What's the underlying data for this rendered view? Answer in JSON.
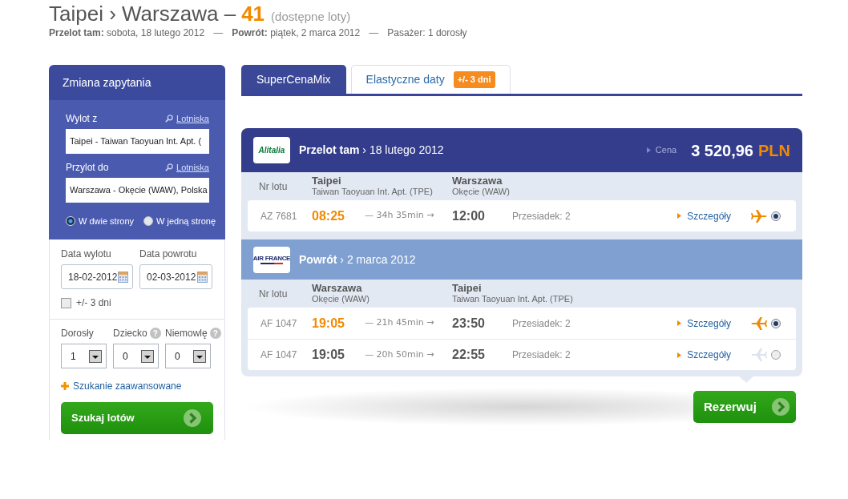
{
  "title": {
    "route": "Taipei › Warszawa –",
    "count": "41",
    "note": "(dostępne loty)"
  },
  "summary": {
    "items": [
      "**Przelot tam:** sobota, 18 lutego 2012",
      "**Powrót:** piątek, 2 marca 2012",
      "Pasażer: 1 dorosły"
    ],
    "separator": "—"
  },
  "sidebar": {
    "title": "Zmiana zapytania",
    "places": [
      {
        "label": "Wylot z",
        "link": "Lotniska",
        "value": "Taipei - Taiwan Taoyuan Int. Apt. ("
      },
      {
        "label": "Przylot do",
        "link": "Lotniska",
        "value": "Warszawa - Okęcie (WAW), Polska"
      }
    ],
    "trip_types": [
      {
        "label": "W dwie strony",
        "selected": true
      },
      {
        "label": "W jedną stronę",
        "selected": false
      }
    ],
    "dates": [
      {
        "label": "Data wylotu",
        "value": "18-02-2012"
      },
      {
        "label": "Data powrotu",
        "value": "02-03-2012"
      }
    ],
    "flexible_dates": {
      "label": "+/- 3 dni",
      "checked": false
    },
    "passengers": [
      {
        "label": "Dorosły",
        "value": "1"
      },
      {
        "label": "Dziecko",
        "help": "?",
        "value": "0"
      },
      {
        "label": "Niemowlę",
        "help": "?",
        "value": "0"
      }
    ],
    "advanced_search": "Szukanie zaawansowane",
    "search_button": "Szukaj lotów"
  },
  "tabs": [
    {
      "label": "SuperCenaMix",
      "selected": true
    },
    {
      "label": "Elastyczne daty",
      "badge": "+/- 3 dni",
      "selected": false
    }
  ],
  "legs": [
    {
      "kind": "outbound",
      "airline_logo": "Alitalia",
      "title": "**Przelot tam** › 18 lutego 2012",
      "price": {
        "label": "Cena",
        "amount": "3 520,96",
        "currency": "PLN"
      },
      "columns": {
        "flight_no": "Nr lotu",
        "from": {
          "city": "Taipei",
          "airport": "Taiwan Taoyuan Int. Apt. (TPE)"
        },
        "to": {
          "city": "Warszawa",
          "airport": "Okęcie (WAW)"
        }
      },
      "flights": [
        {
          "number": "AZ 7681",
          "departure": "08:25",
          "duration": "— 34h 35min →",
          "arrival": "12:00",
          "stops": "Przesiadek: 2",
          "details": "Szczegóły",
          "selected": true
        }
      ]
    },
    {
      "kind": "return",
      "airline_logo": "AIR FRANCE",
      "title": "**Powrót** › 2 marca 2012",
      "columns": {
        "flight_no": "Nr lotu",
        "from": {
          "city": "Warszawa",
          "airport": "Okęcie (WAW)"
        },
        "to": {
          "city": "Taipei",
          "airport": "Taiwan Taoyuan Int. Apt. (TPE)"
        }
      },
      "flights": [
        {
          "number": "AF 1047",
          "departure": "19:05",
          "duration": "— 21h 45min →",
          "arrival": "23:50",
          "stops": "Przesiadek: 2",
          "details": "Szczegóły",
          "selected": true
        },
        {
          "number": "AF 1047",
          "departure": "19:05",
          "duration": "— 20h 50min →",
          "arrival": "22:55",
          "stops": "Przesiadek: 2",
          "details": "Szczegóły",
          "selected": false
        }
      ]
    }
  ],
  "book_button": "Rezerwuj"
}
